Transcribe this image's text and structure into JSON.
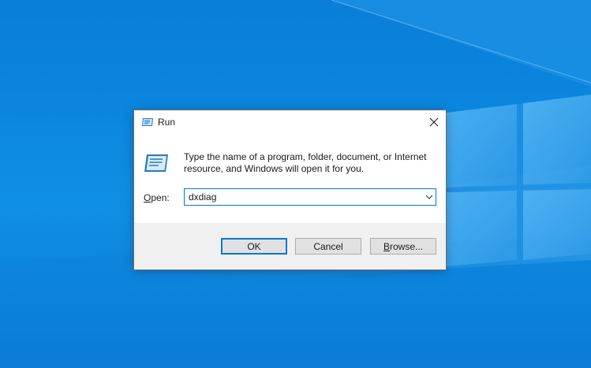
{
  "desktop": {
    "wallpaper": "windows-10-light-blue",
    "colors": {
      "background": "#0b86de",
      "window_pane_light": "#3fa9f0",
      "accent": "#0078d7"
    }
  },
  "dialog": {
    "title": "Run",
    "title_icon": "run-icon",
    "close_icon": "close-icon",
    "description": "Type the name of a program, folder, document, or Internet resource, and Windows will open it for you.",
    "open_label_mnemonic": "O",
    "open_label_rest": "pen:",
    "open_value": "dxdiag",
    "dropdown_icon": "chevron-down-icon",
    "buttons": {
      "ok": "OK",
      "cancel": "Cancel",
      "browse_mnemonic": "B",
      "browse_rest": "rowse..."
    }
  }
}
